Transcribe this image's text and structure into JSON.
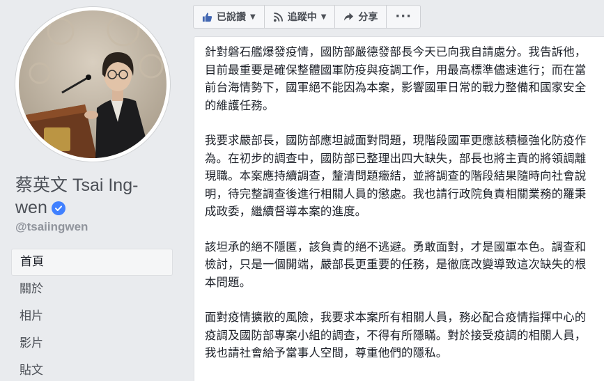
{
  "profile": {
    "name_line1": "蔡英文 Tsai Ing-",
    "name_line2": "wen",
    "handle": "@tsaiingwen",
    "verified": true
  },
  "nav": {
    "items": [
      {
        "label": "首頁",
        "active": true
      },
      {
        "label": "關於",
        "active": false
      },
      {
        "label": "相片",
        "active": false
      },
      {
        "label": "影片",
        "active": false
      },
      {
        "label": "貼文",
        "active": false
      }
    ]
  },
  "toolbar": {
    "liked_label": "已說讚",
    "following_label": "追蹤中",
    "share_label": "分享",
    "more_label": "···"
  },
  "post": {
    "paragraphs": [
      "針對磐石艦爆發疫情，國防部嚴德發部長今天已向我自請處分。我告訴他，目前最重要是確保整體國軍防疫與疫調工作，用最高標準儘速進行；而在當前台海情勢下，國軍絕不能因為本案，影響國軍日常的戰力整備和國家安全的維護任務。",
      "我要求嚴部長，國防部應坦誠面對問題，現階段國軍更應該積極強化防疫作為。在初步的調查中，國防部已整理出四大缺失，部長也將主責的將領調離現職。本案應持續調查，釐清問題癥結，並將調查的階段結果隨時向社會說明，待完整調查後進行相關人員的懲處。我也請行政院負責相關業務的羅秉成政委，繼續督導本案的進度。",
      "該坦承的絕不隱匿，該負責的絕不逃避。勇敢面對，才是國軍本色。調查和檢討，只是一個開端，嚴部長更重要的任務，是徹底改變導致這次缺失的根本問題。",
      "面對疫情擴散的風險，我要求本案所有相關人員，務必配合疫情指揮中心的疫調及國防部專案小組的調查，不得有所隱瞞。對於接受疫調的相關人員，我也請社會給予當事人空間，尊重他們的隱私。"
    ]
  },
  "colors": {
    "brand_blue": "#4267b2",
    "verified_blue": "#4080ff",
    "page_bg": "#e9ebee"
  },
  "icons": {
    "liked": "thumbs-up-icon",
    "following": "rss-icon",
    "share": "share-arrow-icon",
    "verified": "verified-check-icon"
  }
}
